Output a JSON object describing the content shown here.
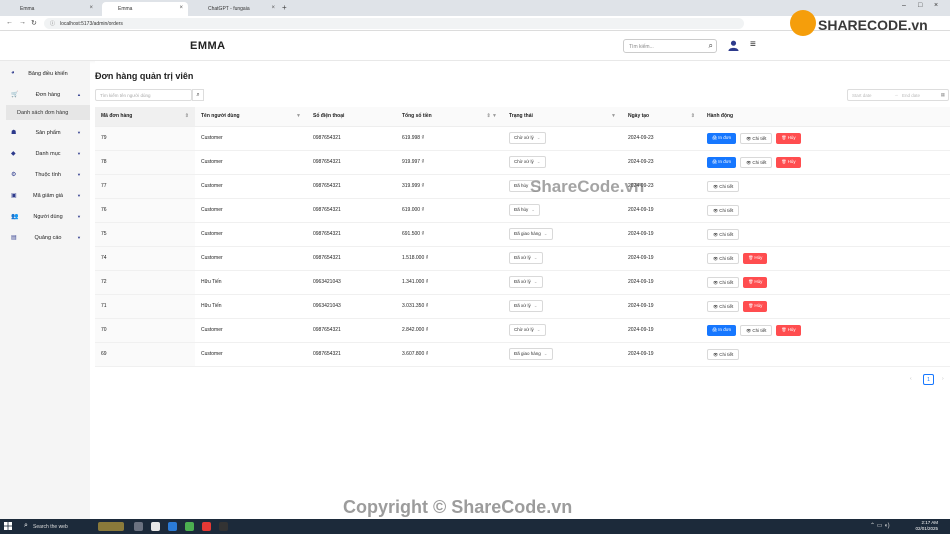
{
  "browser": {
    "tabs": [
      {
        "title": "Emma",
        "active": false
      },
      {
        "title": "Emma",
        "active": true
      },
      {
        "title": "ChatGPT - fungaia",
        "active": false
      }
    ],
    "url": "localhost:5173/admin/orders"
  },
  "header": {
    "logo": "EMMA",
    "search_placeholder": "Tìm kiếm...",
    "accent": "#2d3a8c"
  },
  "sidebar": {
    "items": [
      {
        "label": "Bảng điều khiển",
        "icon": "dashboard-icon"
      },
      {
        "label": "Đơn hàng",
        "icon": "cart-icon",
        "expanded": true
      },
      {
        "label": "Sản phẩm",
        "icon": "products-icon"
      },
      {
        "label": "Danh mục",
        "icon": "tag-icon"
      },
      {
        "label": "Thuộc tính",
        "icon": "gears-icon"
      },
      {
        "label": "Mã giảm giá",
        "icon": "ticket-icon"
      },
      {
        "label": "Người dùng",
        "icon": "users-icon"
      },
      {
        "label": "Quảng cáo",
        "icon": "ad-icon"
      }
    ],
    "sub_item": "Danh sách đơn hàng"
  },
  "main": {
    "title": "Đơn hàng quản trị viên",
    "filter_placeholder": "Tìm kiếm tên người dùng",
    "start_date": "Start date",
    "end_date": "End date",
    "columns": [
      "Mã đơn hàng",
      "Tên người dùng",
      "Số điện thoại",
      "Tổng số tiền",
      "Trạng thái",
      "Ngày tạo",
      "Hành động"
    ],
    "buttons": {
      "print": "In đơn",
      "detail": "Chi tiết",
      "cancel": "Hủy"
    },
    "rows": [
      {
        "id": "79",
        "user": "Customer",
        "phone": "0987654321",
        "total": "619.998 ₫",
        "status": "Chờ xử lý",
        "date": "2024-09-23",
        "actions": [
          "print",
          "detail",
          "cancel"
        ]
      },
      {
        "id": "78",
        "user": "Customer",
        "phone": "0987654321",
        "total": "919.997 ₫",
        "status": "Chờ xử lý",
        "date": "2024-09-23",
        "actions": [
          "print",
          "detail",
          "cancel"
        ]
      },
      {
        "id": "77",
        "user": "Customer",
        "phone": "0987654321",
        "total": "319.999 ₫",
        "status": "Đã hủy",
        "date": "2024-09-23",
        "actions": [
          "detail"
        ]
      },
      {
        "id": "76",
        "user": "Customer",
        "phone": "0987654321",
        "total": "619.000 ₫",
        "status": "Đã hủy",
        "date": "2024-09-19",
        "actions": [
          "detail"
        ]
      },
      {
        "id": "75",
        "user": "Customer",
        "phone": "0987654321",
        "total": "691.500 ₫",
        "status": "Đã giao hàng",
        "date": "2024-09-19",
        "actions": [
          "detail"
        ]
      },
      {
        "id": "74",
        "user": "Customer",
        "phone": "0987654321",
        "total": "1.518.000 ₫",
        "status": "Đã xử lý",
        "date": "2024-09-19",
        "actions": [
          "detail",
          "cancel"
        ]
      },
      {
        "id": "72",
        "user": "Hữu Tiến",
        "phone": "0963421043",
        "total": "1.341.000 ₫",
        "status": "Đã xử lý",
        "date": "2024-09-19",
        "actions": [
          "detail",
          "cancel"
        ]
      },
      {
        "id": "71",
        "user": "Hữu Tiến",
        "phone": "0963421043",
        "total": "3.031.350 ₫",
        "status": "Đã xử lý",
        "date": "2024-09-19",
        "actions": [
          "detail",
          "cancel"
        ]
      },
      {
        "id": "70",
        "user": "Customer",
        "phone": "0987654321",
        "total": "2.842.000 ₫",
        "status": "Chờ xử lý",
        "date": "2024-09-19",
        "actions": [
          "print",
          "detail",
          "cancel"
        ]
      },
      {
        "id": "69",
        "user": "Customer",
        "phone": "0987654321",
        "total": "3.607.800 ₫",
        "status": "Đã giao hàng",
        "date": "2024-09-19",
        "actions": [
          "detail"
        ]
      }
    ],
    "current_page": "1"
  },
  "watermarks": {
    "logo_text": "SHARECODE.vn",
    "center": "ShareCode.vn",
    "bottom": "Copyright © ShareCode.vn"
  },
  "taskbar": {
    "search_placeholder": "Search the web",
    "time": "2:17 AM",
    "date": "02/01/2025"
  }
}
